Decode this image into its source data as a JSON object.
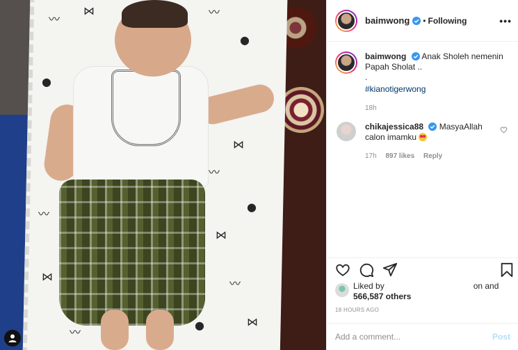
{
  "post": {
    "image_alt": "Baby sleeping on a mustache-patterned blanket wearing a white shirt and green plaid sarong"
  },
  "header": {
    "username": "baimwong",
    "separator": "•",
    "follow_label": "Following",
    "more_label": "•••"
  },
  "caption": {
    "username": "baimwong",
    "text": "Anak Sholeh nemenin Papah Sholat ..",
    "dot": ".",
    "hashtag": "#kianotigerwong",
    "time": "18h"
  },
  "comment": {
    "username": "chikajessica88",
    "text": "MasyaAllah calon imamku",
    "time": "17h",
    "likes": "897 likes",
    "reply": "Reply"
  },
  "likes": {
    "prefix": "Liked by",
    "suffix": "on and",
    "count": "566,587 others"
  },
  "timestamp": "18 HOURS AGO",
  "add_comment": {
    "placeholder": "Add a comment...",
    "post_label": "Post"
  },
  "icons": {
    "verified": "verified-badge-icon",
    "heart": "heart-icon",
    "comment": "comment-icon",
    "share": "share-icon",
    "save": "bookmark-icon",
    "profile": "profile-icon"
  },
  "colors": {
    "verified": "#3897f0",
    "link": "#00376b",
    "muted": "#8e8e8e",
    "post_disabled": "#b2dffc"
  }
}
